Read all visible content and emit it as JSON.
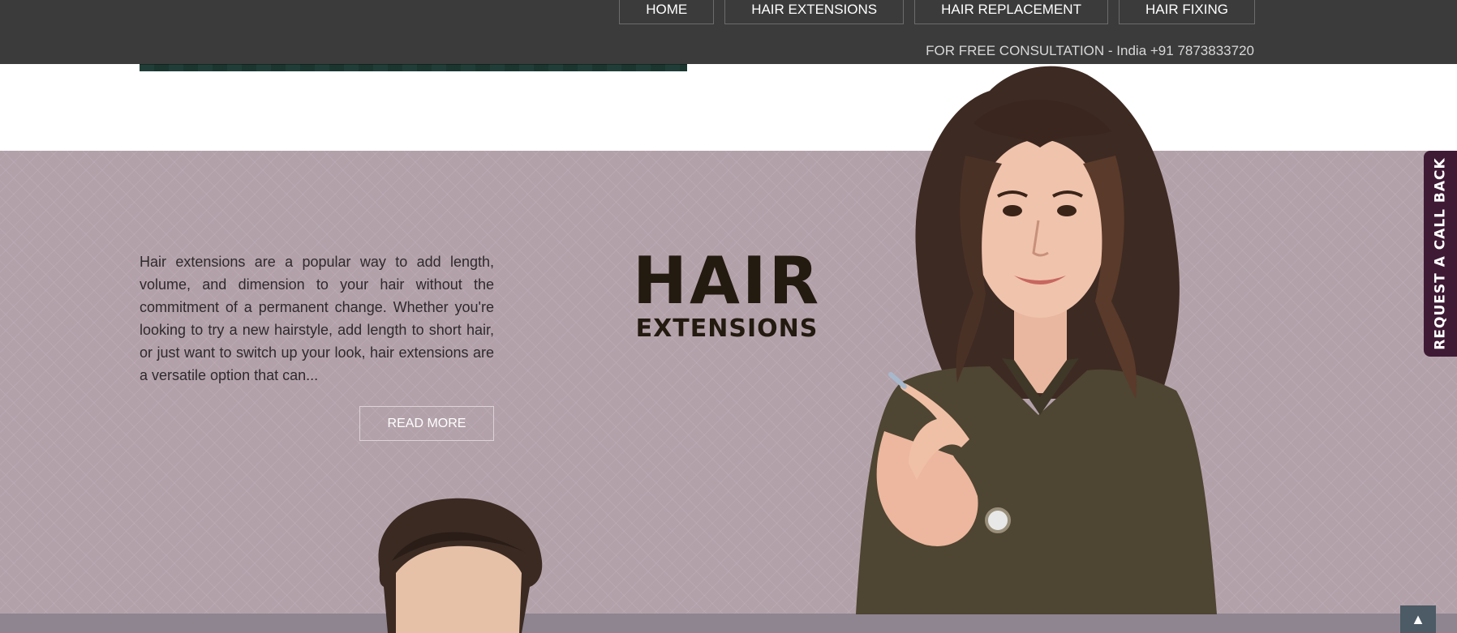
{
  "nav": {
    "items": [
      {
        "label": "HOME"
      },
      {
        "label": "HAIR EXTENSIONS"
      },
      {
        "label": "HAIR REPLACEMENT"
      },
      {
        "label": "HAIR FIXING"
      }
    ]
  },
  "header": {
    "consultation": "FOR FREE CONSULTATION - India +91 7873833720"
  },
  "section": {
    "description": "Hair extensions are a popular way to add length, volume, and dimension to your hair without the commitment of a permanent change. Whether you're looking to try a new hairstyle, add length to short hair, or just want to switch up your look, hair extensions are a versatile option that can...",
    "read_more": "READ MORE",
    "heading_big": "HAIR",
    "heading_small": "EXTENSIONS"
  },
  "side_tab": {
    "label": "REQUEST A CALL BACK"
  },
  "scroll_top": {
    "icon": "arrow-up-icon",
    "glyph": "▲"
  },
  "colors": {
    "header_bg": "#3b3b3b",
    "band_bg": "#b3a1aa",
    "callback_bg": "#3f1a35",
    "scroll_top_bg": "#4c5b66"
  }
}
